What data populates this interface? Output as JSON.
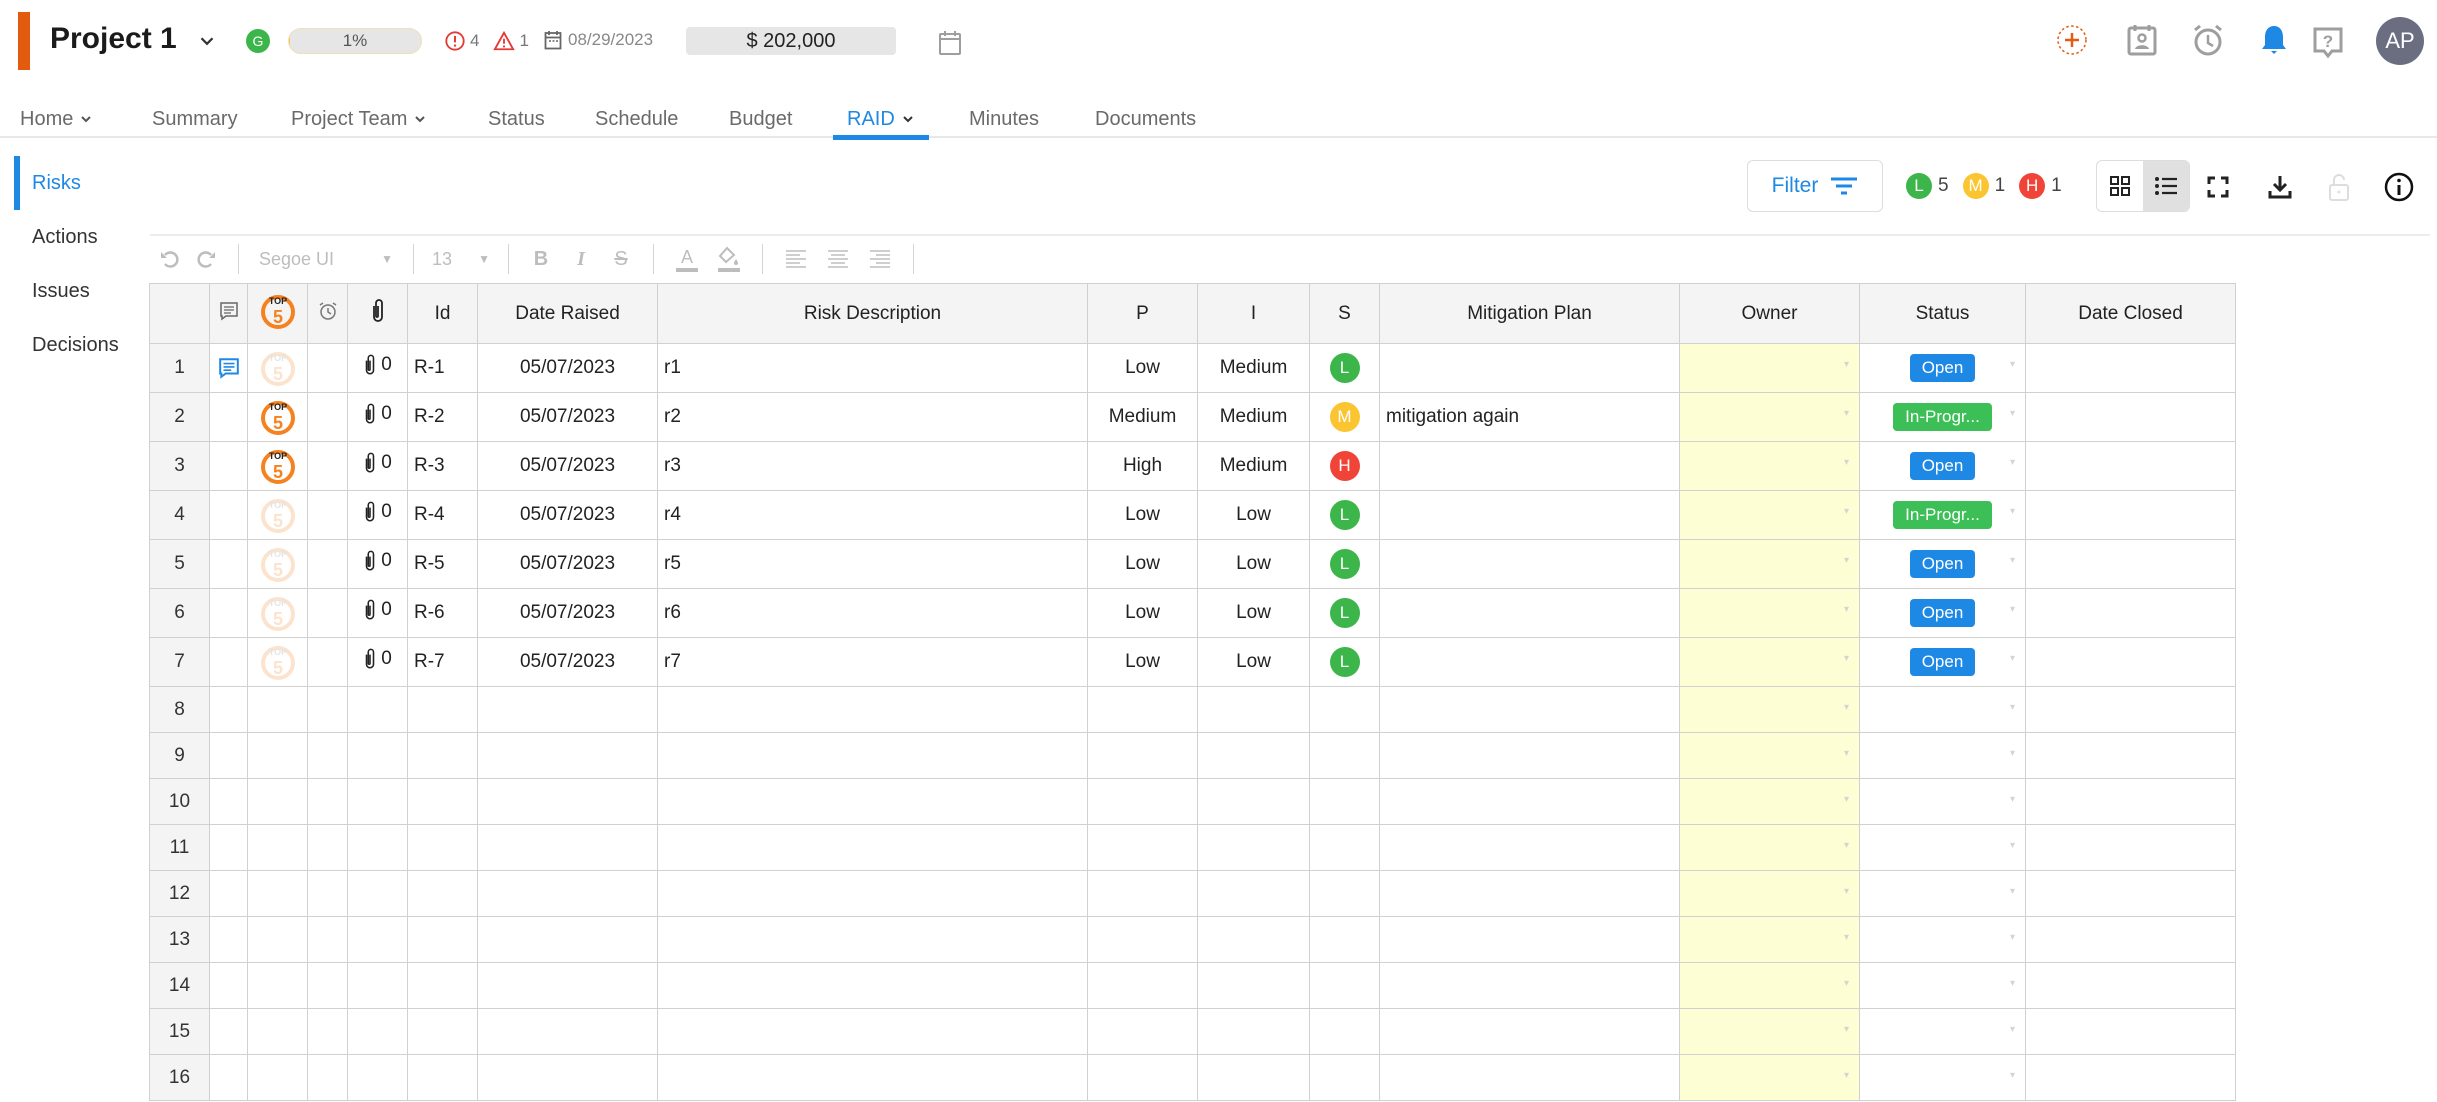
{
  "header": {
    "project_title": "Project 1",
    "health": "G",
    "progress_label": "1%",
    "progress_value": 0.01,
    "issues_count": "4",
    "warnings_count": "1",
    "date": "08/29/2023",
    "budget": "$ 202,000",
    "avatar_initials": "AP"
  },
  "colors": {
    "accent": "#e35b0e",
    "primary": "#1e88e5",
    "low": "#3cb54a",
    "medium": "#fbc531",
    "high": "#f04438",
    "open": "#1e88e5",
    "in_progress": "#3dbf57",
    "owner_bg": "#fefed4"
  },
  "nav": {
    "tabs": [
      {
        "label": "Home",
        "dropdown": true
      },
      {
        "label": "Summary"
      },
      {
        "label": "Project Team",
        "dropdown": true
      },
      {
        "label": "Status"
      },
      {
        "label": "Schedule"
      },
      {
        "label": "Budget"
      },
      {
        "label": "RAID",
        "dropdown": true,
        "active": true
      },
      {
        "label": "Minutes"
      },
      {
        "label": "Documents"
      }
    ]
  },
  "sidebar": {
    "items": [
      {
        "label": "Risks",
        "active": true
      },
      {
        "label": "Actions"
      },
      {
        "label": "Issues"
      },
      {
        "label": "Decisions"
      }
    ]
  },
  "toolbar": {
    "filter_label": "Filter",
    "severity_counts": [
      {
        "letter": "L",
        "count": "5"
      },
      {
        "letter": "M",
        "count": "1"
      },
      {
        "letter": "H",
        "count": "1"
      }
    ]
  },
  "format_bar": {
    "font": "Segoe UI",
    "size": "13"
  },
  "grid": {
    "columns": [
      "",
      "",
      "",
      "",
      "",
      "Id",
      "Date Raised",
      "Risk Description",
      "P",
      "I",
      "S",
      "Mitigation Plan",
      "Owner",
      "Status",
      "Date Closed"
    ],
    "rows": [
      {
        "num": "1",
        "comment": true,
        "top5": false,
        "attachments": "0",
        "id": "R-1",
        "date_raised": "05/07/2023",
        "description": "r1",
        "p": "Low",
        "i": "Medium",
        "s": "L",
        "mitigation": "",
        "owner": "",
        "status": "Open",
        "date_closed": ""
      },
      {
        "num": "2",
        "comment": false,
        "top5": true,
        "attachments": "0",
        "id": "R-2",
        "date_raised": "05/07/2023",
        "description": "r2",
        "p": "Medium",
        "i": "Medium",
        "s": "M",
        "mitigation": "mitigation again",
        "owner": "",
        "status": "In-Progr...",
        "date_closed": ""
      },
      {
        "num": "3",
        "comment": false,
        "top5": true,
        "attachments": "0",
        "id": "R-3",
        "date_raised": "05/07/2023",
        "description": "r3",
        "p": "High",
        "i": "Medium",
        "s": "H",
        "mitigation": "",
        "owner": "",
        "status": "Open",
        "date_closed": ""
      },
      {
        "num": "4",
        "comment": false,
        "top5": false,
        "attachments": "0",
        "id": "R-4",
        "date_raised": "05/07/2023",
        "description": "r4",
        "p": "Low",
        "i": "Low",
        "s": "L",
        "mitigation": "",
        "owner": "",
        "status": "In-Progr...",
        "date_closed": ""
      },
      {
        "num": "5",
        "comment": false,
        "top5": false,
        "attachments": "0",
        "id": "R-5",
        "date_raised": "05/07/2023",
        "description": "r5",
        "p": "Low",
        "i": "Low",
        "s": "L",
        "mitigation": "",
        "owner": "",
        "status": "Open",
        "date_closed": ""
      },
      {
        "num": "6",
        "comment": false,
        "top5": false,
        "attachments": "0",
        "id": "R-6",
        "date_raised": "05/07/2023",
        "description": "r6",
        "p": "Low",
        "i": "Low",
        "s": "L",
        "mitigation": "",
        "owner": "",
        "status": "Open",
        "date_closed": ""
      },
      {
        "num": "7",
        "comment": false,
        "top5": false,
        "attachments": "0",
        "id": "R-7",
        "date_raised": "05/07/2023",
        "description": "r7",
        "p": "Low",
        "i": "Low",
        "s": "L",
        "mitigation": "",
        "owner": "",
        "status": "Open",
        "date_closed": ""
      }
    ],
    "empty_row_numbers": [
      "8",
      "9",
      "10",
      "11",
      "12",
      "13",
      "14",
      "15",
      "16"
    ]
  }
}
